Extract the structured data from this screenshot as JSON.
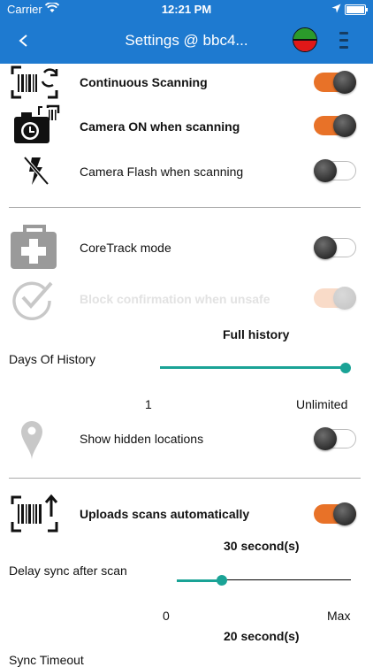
{
  "status_bar": {
    "carrier": "Carrier",
    "time": "12:21 PM"
  },
  "header": {
    "title": "Settings @ bbc4..."
  },
  "scan_settings": [
    {
      "label": "Continuous Scanning",
      "on": true,
      "icon": "barcode-refresh-icon"
    },
    {
      "label": "Camera ON when scanning",
      "on": true,
      "icon": "camera-barcode-icon"
    },
    {
      "label": "Camera Flash when scanning",
      "on": false,
      "icon": "flash-off-icon"
    }
  ],
  "coretrack": {
    "label": "CoreTrack mode",
    "on": false,
    "icon": "medkit-icon"
  },
  "block_confirmation": {
    "label": "Block confirmation when unsafe",
    "on": true,
    "disabled": true,
    "icon": "check-circle-icon"
  },
  "days_of_history": {
    "value_text": "Full history",
    "label": "Days Of History",
    "min_label": "1",
    "max_label": "Unlimited",
    "fraction": 1.0
  },
  "hidden_locations": {
    "label": "Show hidden locations",
    "on": false,
    "icon": "location-pin-icon"
  },
  "uploads": {
    "label": "Uploads scans automatically",
    "on": true,
    "icon": "barcode-upload-icon"
  },
  "delay_sync": {
    "value_text": "30 second(s)",
    "label": "Delay sync after scan",
    "min_label": "0",
    "max_label": "Max",
    "fraction": 0.26
  },
  "sync_timeout": {
    "value_text": "20 second(s)",
    "label": "Sync Timeout"
  },
  "colors": {
    "header": "#1e7ad0",
    "toggle_on": "#e87228",
    "slider": "#1aa396"
  }
}
